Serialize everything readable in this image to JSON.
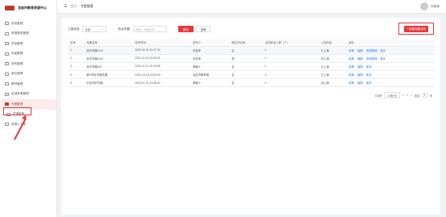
{
  "logo": {
    "text": "龙岩市教育资源中心"
  },
  "sidebar": {
    "items": [
      {
        "label": "系统管理",
        "active": false,
        "sub": false
      },
      {
        "label": "资源类型管理",
        "active": false,
        "sub": false
      },
      {
        "label": "学段管理",
        "active": false,
        "sub": false
      },
      {
        "label": "年级管理",
        "active": false,
        "sub": false
      },
      {
        "label": "学科管理",
        "active": false,
        "sub": false
      },
      {
        "label": "单位管理",
        "active": false,
        "sub": false
      },
      {
        "label": "教材管理",
        "active": false,
        "sub": false
      },
      {
        "label": "区域资源管理",
        "active": false,
        "sub": false
      },
      {
        "label": "专题管理",
        "active": true,
        "sub": false
      },
      {
        "label": "资源审核",
        "active": false,
        "sub": true
      },
      {
        "label": "资源上下架",
        "active": false,
        "sub": false
      }
    ]
  },
  "topbar": {
    "menu_icon": "☰",
    "crumb_home": "首页",
    "crumb_sep": "/",
    "crumb_current": "专题管理",
    "user_name": "刘老师"
  },
  "filters": {
    "status_label": "上架状态:",
    "status_value": "全部",
    "topic_label": "前台专题:",
    "topic_placeholder": "请输入专题名称",
    "search_btn": "查询",
    "reset_btn": "重置"
  },
  "new_button": "+ 新增专题活动",
  "table": {
    "headers": [
      "序号",
      "专题名称",
      "发布时间",
      "发布人",
      "是否可回收",
      "活动参加人数（个）",
      "上架状态",
      "操作"
    ],
    "rows": [
      {
        "no": "1",
        "name": "测试专题1112",
        "time": "2022-11-02 10:47:32",
        "user": "刘老师",
        "recycle": "否",
        "count": "0",
        "status": "已上架",
        "actions": [
          "查看",
          "编辑",
          "资源管理",
          "更多"
        ],
        "selected": true
      },
      {
        "no": "2",
        "name": "测试专题1102",
        "time": "2022-11-02 10:03:21",
        "user": "刘老师",
        "recycle": "是",
        "count": "0",
        "status": "待上架",
        "actions": [
          "查看",
          "编辑",
          "资源管理",
          "更多"
        ],
        "selected": false
      },
      {
        "no": "3",
        "name": "测试专题001",
        "time": "2022-11-01 15:10:08",
        "user": "审稿人",
        "recycle": "否",
        "count": "0",
        "status": "已上架",
        "actions": [
          "查看",
          "编辑",
          "更多"
        ],
        "selected": false
      },
      {
        "no": "4",
        "name": "新E学校专题资源",
        "time": "2022-10-20 15:29:00",
        "user": "龙岩市教育局",
        "recycle": "否",
        "count": "0",
        "status": "已上架",
        "actions": [
          "查看",
          "编辑",
          "更多"
        ],
        "selected": false
      },
      {
        "no": "5",
        "name": "历史内的专题",
        "time": "2022-07-21 13:36:01",
        "user": "审稿人",
        "recycle": "否",
        "count": "0",
        "status": "待上架",
        "actions": [
          "查看",
          "编辑",
          "更多"
        ],
        "selected": false
      }
    ]
  },
  "pager": {
    "total": "共5条",
    "page_size": "10条/页",
    "prev": "<",
    "current": "1",
    "next": ">",
    "goto_label": "前往",
    "goto_value": "1",
    "page_unit": "页"
  }
}
